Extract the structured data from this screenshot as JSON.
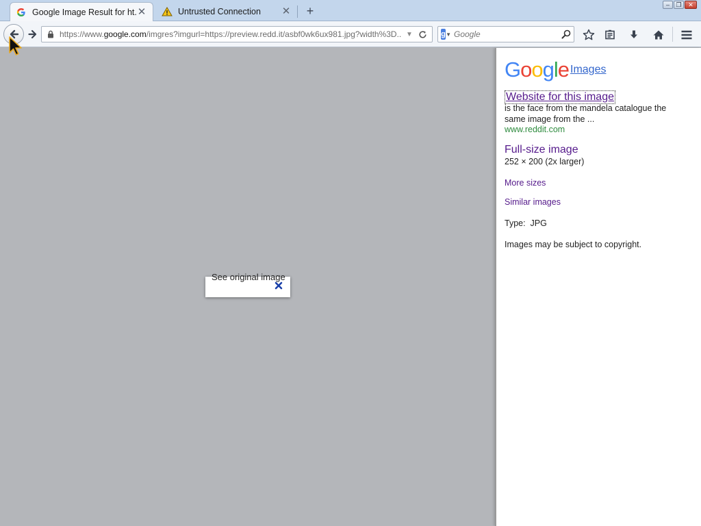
{
  "browser": {
    "tabs": [
      {
        "label": "Google Image Result for ht...",
        "active": true,
        "icon": "google-g-icon"
      },
      {
        "label": "Untrusted Connection",
        "active": false,
        "icon": "warning-icon"
      }
    ],
    "new_tab_label": "+",
    "window_buttons": {
      "minimize": "–",
      "restore": "❐",
      "close": "✕"
    }
  },
  "navbar": {
    "url_prefix": "https://www.",
    "url_domain": "google.com",
    "url_rest": "/imgres?imgurl=https://preview.redd.it/asbf0wk6ux981.jpg?width%3D...",
    "search_placeholder": "Google",
    "search_engine_letter": "g"
  },
  "viewer": {
    "popup_text": "See original image"
  },
  "sidebar": {
    "logo_letters": [
      "G",
      "o",
      "o",
      "g",
      "l",
      "e"
    ],
    "logo_colors": [
      "#4285f4",
      "#ea4335",
      "#fbbc05",
      "#4285f4",
      "#34a853",
      "#ea4335"
    ],
    "images_label": "Images",
    "website_label": "Website for this image",
    "description": "is the face from the mandela catalogue the same image from the ...",
    "site": "www.reddit.com",
    "fullsize_label": "Full-size image",
    "dimensions": "252 × 200 (2x larger)",
    "more_sizes_label": "More sizes",
    "similar_label": "Similar images",
    "type_text": "Type:  JPG",
    "copyright": "Images may be subject to copyright."
  },
  "colors": {
    "link": "#551a8b",
    "site_green": "#2e8b3e",
    "viewer_bg": "#b4b6ba"
  }
}
